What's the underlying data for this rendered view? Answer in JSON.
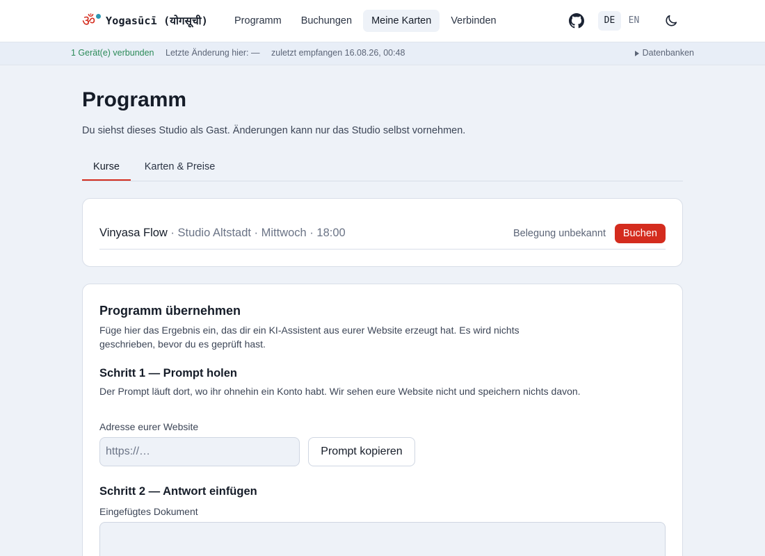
{
  "header": {
    "brand": "Yogasūcī (योगसूची)",
    "om_glyph": "ॐ",
    "nav": [
      {
        "label": "Programm"
      },
      {
        "label": "Buchungen"
      },
      {
        "label": "Meine Karten"
      },
      {
        "label": "Verbinden"
      }
    ],
    "active_nav": "Meine Karten",
    "lang": [
      "DE",
      "EN"
    ],
    "active_lang": "DE",
    "icons": [
      "github-icon",
      "moon-icon"
    ]
  },
  "sync": {
    "devices": "1 Gerät(e) verbunden",
    "last_change": "Letzte Änderung hier: —",
    "received": "zuletzt empfangen 16.08.26, 00:48",
    "databases": "Datenbanken"
  },
  "main": {
    "title": "Programm",
    "guest_note": "Du siehst dieses Studio als Gast. Änderungen kann nur das Studio selbst vornehmen.",
    "tabs": [
      {
        "label": "Kurse"
      },
      {
        "label": "Karten & Preise"
      }
    ],
    "active_tab": "Kurse"
  },
  "course": {
    "name": "Vinyasa Flow",
    "meta": " · Studio Altstadt · Mittwoch · 18:00",
    "occupancy": "Belegung unbekannt",
    "book_label": "Buchen"
  },
  "import": {
    "title": "Programm übernehmen",
    "desc": "Füge hier das Ergebnis ein, das dir ein KI-Assistent aus eurer Website erzeugt hat. Es wird nichts geschrieben, bevor du es geprüft hast.",
    "step1_title": "Schritt 1 — Prompt holen",
    "step1_desc": "Der Prompt läuft dort, wo ihr ohnehin ein Konto habt. Wir sehen eure Website nicht und speichern nichts davon.",
    "url_label": "Adresse eurer Website",
    "url_placeholder": "https://…",
    "url_value": "",
    "copy_label": "Prompt kopieren",
    "step2_title": "Schritt 2 — Antwort einfügen",
    "doc_label": "Eingefügtes Dokument",
    "doc_value": ""
  },
  "colors": {
    "accent": "#d42c1e",
    "sync_ok": "#2b8a58",
    "background": "#eef2f8"
  }
}
